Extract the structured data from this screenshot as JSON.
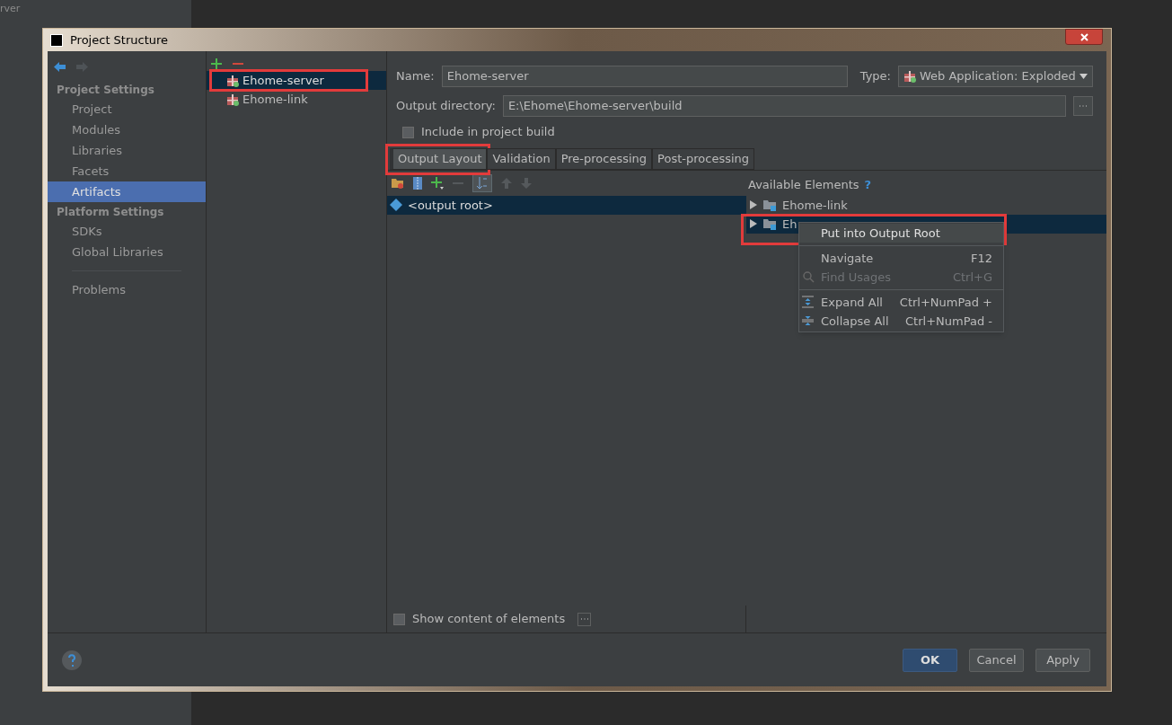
{
  "background": {
    "title_fragment": "rver"
  },
  "dialog": {
    "title": "Project Structure",
    "sidebar": {
      "sections": [
        {
          "title": "Project Settings",
          "items": [
            {
              "label": "Project",
              "selected": false
            },
            {
              "label": "Modules",
              "selected": false
            },
            {
              "label": "Libraries",
              "selected": false
            },
            {
              "label": "Facets",
              "selected": false
            },
            {
              "label": "Artifacts",
              "selected": true
            }
          ]
        },
        {
          "title": "Platform Settings",
          "items": [
            {
              "label": "SDKs",
              "selected": false
            },
            {
              "label": "Global Libraries",
              "selected": false
            }
          ]
        }
      ],
      "extra_items": [
        {
          "label": "Problems",
          "selected": false
        }
      ]
    },
    "artifacts": [
      {
        "name": "Ehome-server",
        "selected": true
      },
      {
        "name": "Ehome-link",
        "selected": false
      }
    ],
    "name_field": {
      "label": "Name:",
      "value": "Ehome-server"
    },
    "type_field": {
      "label": "Type:",
      "value": "Web Application: Exploded"
    },
    "output_directory": {
      "label": "Output directory:",
      "value": "E:\\Ehome\\Ehome-server\\build"
    },
    "include_in_build": {
      "label": "Include in project build",
      "checked": false
    },
    "tabs": [
      {
        "label": "Output Layout",
        "selected": true
      },
      {
        "label": "Validation",
        "selected": false
      },
      {
        "label": "Pre-processing",
        "selected": false
      },
      {
        "label": "Post-processing",
        "selected": false
      }
    ],
    "layout_tree": [
      {
        "label": "<output root>",
        "selected": true
      }
    ],
    "available_elements": {
      "title": "Available Elements",
      "help": "?",
      "items": [
        {
          "label": "Ehome-link",
          "selected": false
        },
        {
          "label": "Eh",
          "selected": true
        }
      ]
    },
    "context_menu": [
      {
        "kind": "plain",
        "label": "Put into Output Root",
        "selected": true,
        "disabled": false,
        "separator_before": false
      },
      {
        "kind": "plain",
        "label": "Navigate",
        "shortcut": "F12",
        "selected": false,
        "disabled": false,
        "separator_before": true
      },
      {
        "kind": "find",
        "label": "Find Usages",
        "shortcut": "Ctrl+G",
        "selected": false,
        "disabled": true,
        "separator_before": false
      },
      {
        "kind": "expand",
        "label": "Expand All",
        "shortcut": "Ctrl+NumPad +",
        "selected": false,
        "disabled": false,
        "separator_before": true
      },
      {
        "kind": "collapse",
        "label": "Collapse All",
        "shortcut": "Ctrl+NumPad -",
        "selected": false,
        "disabled": false,
        "separator_before": false
      }
    ],
    "show_content": {
      "label": "Show content of elements",
      "checked": false
    },
    "buttons": [
      {
        "label": "OK",
        "kind": "default"
      },
      {
        "label": "Cancel",
        "kind": "normal"
      },
      {
        "label": "Apply",
        "kind": "normal"
      }
    ]
  }
}
